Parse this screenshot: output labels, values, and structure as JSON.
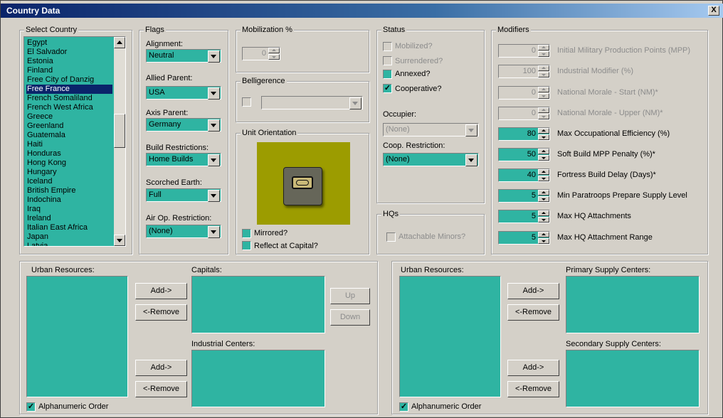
{
  "window": {
    "title": "Country Data",
    "close": "X"
  },
  "select_country": {
    "label": "Select Country",
    "items": [
      "Egypt",
      "El Salvador",
      "Estonia",
      "Finland",
      "Free City of Danzig",
      "Free France",
      "French Somaliland",
      "French West Africa",
      "Greece",
      "Greenland",
      "Guatemala",
      "Haiti",
      "Honduras",
      "Hong Kong",
      "Hungary",
      "Iceland",
      "British Empire",
      "Indochina",
      "Iraq",
      "Ireland",
      "Italian East Africa",
      "Japan",
      "Latvia"
    ],
    "selected": "Free France"
  },
  "flags": {
    "label": "Flags",
    "alignment": {
      "label": "Alignment:",
      "value": "Neutral"
    },
    "allied_parent": {
      "label": "Allied Parent:",
      "value": "USA"
    },
    "axis_parent": {
      "label": "Axis Parent:",
      "value": "Germany"
    },
    "build_restrictions": {
      "label": "Build Restrictions:",
      "value": "Home Builds"
    },
    "scorched_earth": {
      "label": "Scorched Earth:",
      "value": "Full"
    },
    "air_op_restriction": {
      "label": "Air Op. Restriction:",
      "value": "(None)"
    }
  },
  "mobilization": {
    "label": "Mobilization %",
    "value": "0"
  },
  "belligerence": {
    "label": "Belligerence",
    "value": ""
  },
  "unit_orientation": {
    "label": "Unit Orientation",
    "mirrored": "Mirrored?",
    "reflect": "Reflect at Capital?"
  },
  "status": {
    "label": "Status",
    "mobilized": "Mobilized?",
    "surrendered": "Surrendered?",
    "annexed": "Annexed?",
    "cooperative": "Cooperative?",
    "occupier": {
      "label": "Occupier:",
      "value": "(None)"
    },
    "coop_restriction": {
      "label": "Coop. Restriction:",
      "value": "(None)"
    }
  },
  "hqs": {
    "label": "HQs",
    "attachable": "Attachable Minors?"
  },
  "modifiers": {
    "label": "Modifiers",
    "rows": [
      {
        "value": "0",
        "label": "Initial Military Production Points (MPP)"
      },
      {
        "value": "100",
        "label": "Industrial Modifier (%)"
      },
      {
        "value": "0",
        "label": "National Morale - Start (NM)*"
      },
      {
        "value": "0",
        "label": "National Morale - Upper (NM)*"
      },
      {
        "value": "80",
        "label": "Max Occupational Efficiency (%)"
      },
      {
        "value": "50",
        "label": "Soft Build MPP Penalty (%)*"
      },
      {
        "value": "40",
        "label": "Fortress Build Delay (Days)*"
      },
      {
        "value": "5",
        "label": "Min Paratroops Prepare Supply Level"
      },
      {
        "value": "5",
        "label": "Max HQ Attachments"
      },
      {
        "value": "5",
        "label": "Max HQ Attachment Range"
      }
    ]
  },
  "left_panel": {
    "urban_label": "Urban Resources:",
    "capitals_label": "Capitals:",
    "industrial_label": "Industrial Centers:",
    "add": "Add->",
    "remove": "<-Remove",
    "up": "Up",
    "down": "Down",
    "alpha": "Alphanumeric Order"
  },
  "right_panel": {
    "urban_label": "Urban Resources:",
    "primary_label": "Primary Supply Centers:",
    "secondary_label": "Secondary Supply Centers:",
    "add": "Add->",
    "remove": "<-Remove",
    "alpha": "Alphanumeric Order"
  },
  "colors": {
    "teal": "#2fb4a2",
    "panel": "#d4d0c8",
    "olive": "#9c9c00",
    "title_blue": "#0a246a"
  }
}
